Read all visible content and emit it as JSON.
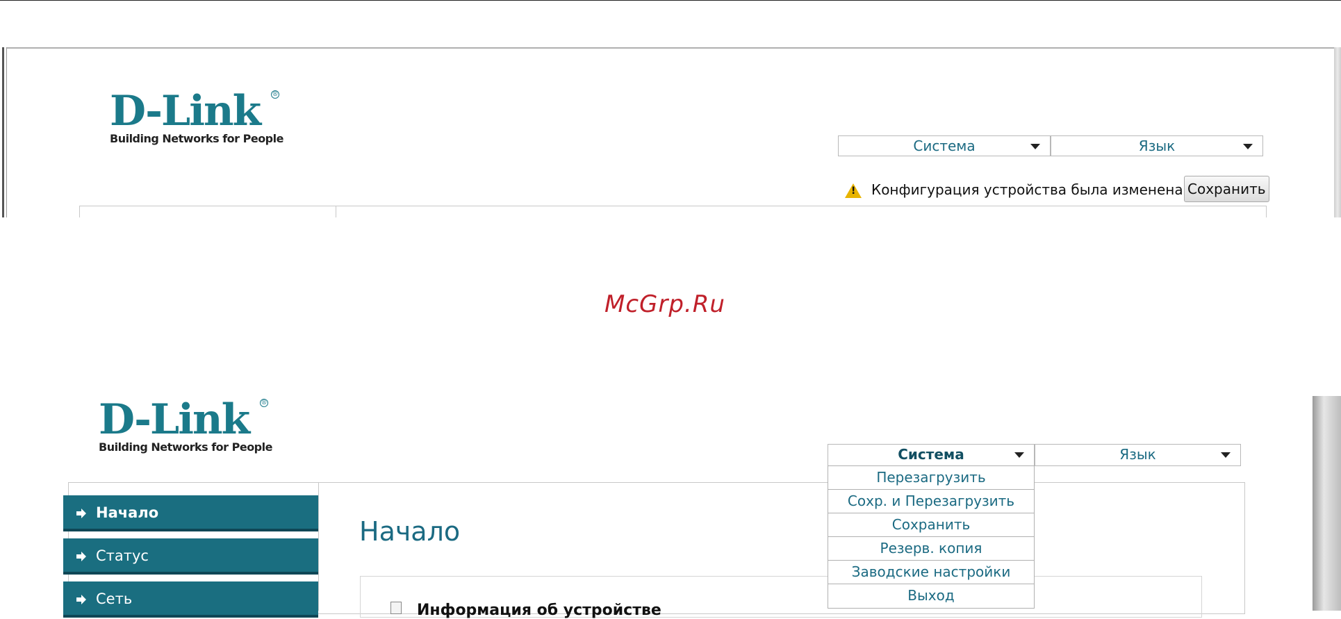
{
  "top": {
    "logo": {
      "brand": "D-Link",
      "registered": "®",
      "tagline": "Building Networks for People"
    },
    "menus": [
      {
        "label": "Система"
      },
      {
        "label": "Язык"
      }
    ],
    "notice": {
      "text": "Конфигурация устройства была изменена",
      "icon": "warning-icon",
      "icon_glyph": "!"
    },
    "save_button": "Сохранить"
  },
  "watermark": "McGrp.Ru",
  "bottom": {
    "logo": {
      "brand": "D-Link",
      "registered": "®",
      "tagline": "Building Networks for People"
    },
    "menus": [
      {
        "label": "Система"
      },
      {
        "label": "Язык"
      }
    ],
    "system_menu_items": [
      "Перезагрузить",
      "Сохр. и Перезагрузить",
      "Сохранить",
      "Резерв. копия",
      "Заводские настройки",
      "Выход"
    ],
    "sidebar": [
      {
        "label": "Начало",
        "active": true
      },
      {
        "label": "Статус",
        "active": false
      },
      {
        "label": "Сеть",
        "active": false
      }
    ],
    "page_title": "Начало",
    "section_title": "Информация об устройстве"
  },
  "colors": {
    "accent": "#1b7a8a",
    "sidebar_bg": "#1a6e80",
    "link_text": "#1b6a82",
    "watermark": "#c0202a",
    "warning": "#e8b400"
  }
}
